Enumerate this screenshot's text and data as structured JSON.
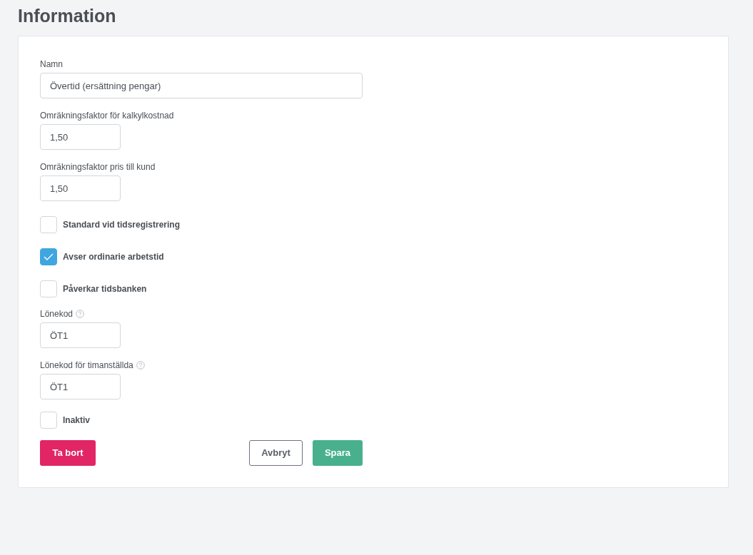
{
  "title": "Information",
  "items": [
    {
      "kind": "wide-field",
      "label": "Namn",
      "help": false,
      "value": "Övertid (ersättning pengar)"
    },
    {
      "kind": "short-field",
      "label": "Omräkningsfaktor för kalkylkostnad",
      "help": false,
      "value": "1,50"
    },
    {
      "kind": "short-field",
      "label": "Omräkningsfaktor pris till kund",
      "help": false,
      "value": "1,50"
    },
    {
      "kind": "checkbox",
      "label": "Standard vid tidsregistrering",
      "checked": false
    },
    {
      "kind": "checkbox",
      "label": "Avser ordinarie arbetstid",
      "checked": true
    },
    {
      "kind": "checkbox",
      "label": "Påverkar tidsbanken",
      "checked": false
    },
    {
      "kind": "short-field",
      "label": "Lönekod",
      "help": true,
      "value": "ÖT1"
    },
    {
      "kind": "short-field",
      "label": "Lönekod för timanställda",
      "help": true,
      "value": "ÖT1"
    },
    {
      "kind": "checkbox-tight",
      "label": "Inaktiv",
      "checked": false
    }
  ],
  "buttons": {
    "delete": "Ta bort",
    "cancel": "Avbryt",
    "save": "Spara"
  }
}
